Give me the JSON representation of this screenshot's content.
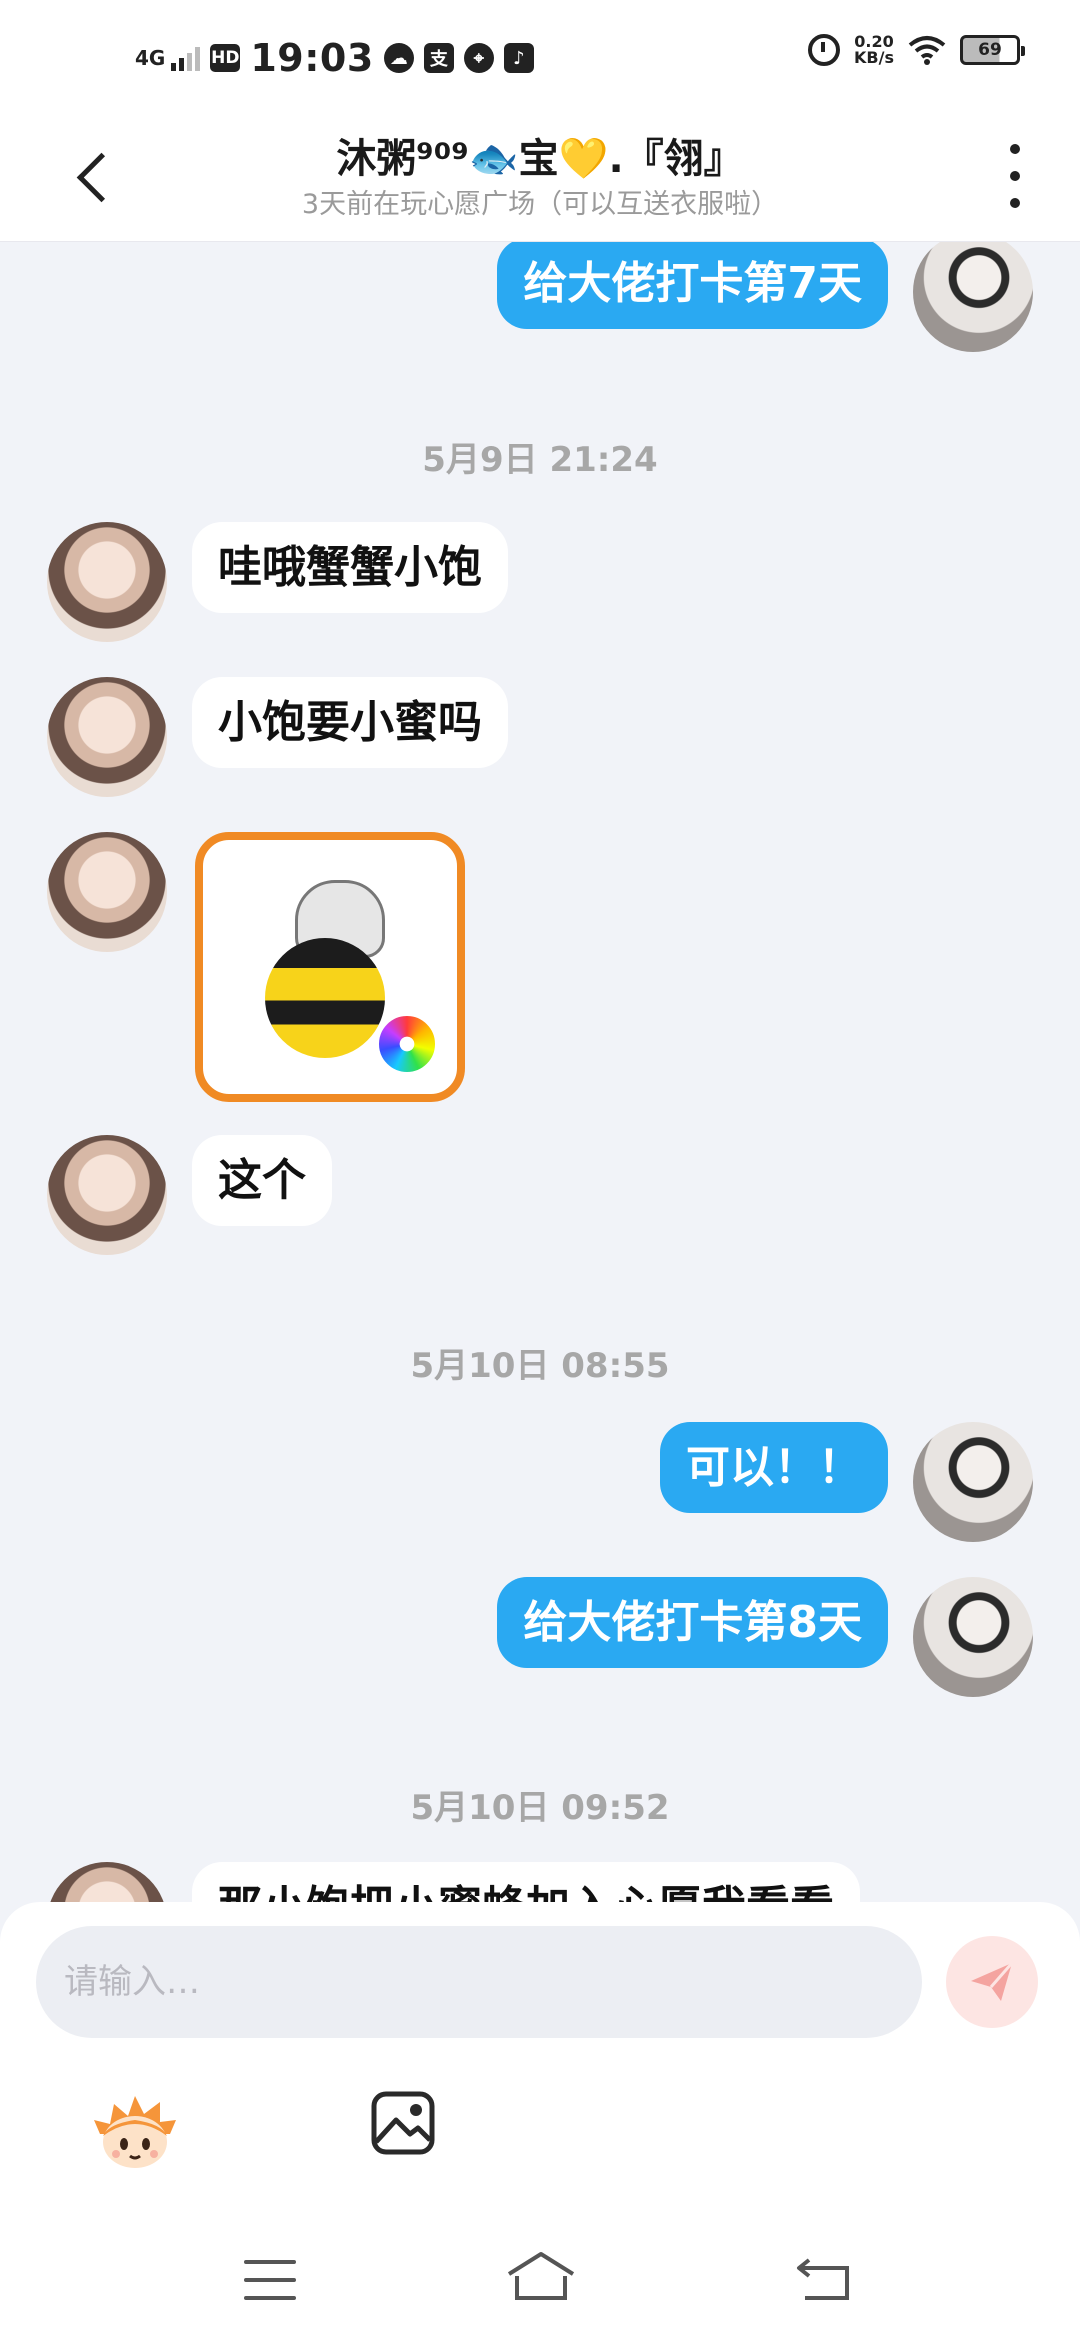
{
  "status_bar": {
    "network": "4G",
    "hd": "HD",
    "time": "19:03",
    "speed_value": "0.20",
    "speed_unit": "KB/s",
    "battery": "69"
  },
  "header": {
    "title": "沐粥⁹⁰⁹🐟宝💛.『翎』",
    "subtitle": "3天前在玩心愿广场（可以互送衣服啦）"
  },
  "messages": [
    {
      "side": "out",
      "text": "给大佬打卡第7天"
    },
    {
      "type": "time",
      "text": "5月9日 21:24"
    },
    {
      "side": "in",
      "text": "哇哦蟹蟹小饱"
    },
    {
      "side": "in",
      "text": "小饱要小蜜吗"
    },
    {
      "side": "in",
      "type": "sticker"
    },
    {
      "side": "in",
      "text": "这个"
    },
    {
      "type": "time",
      "text": "5月10日 08:55"
    },
    {
      "side": "out",
      "text": "可以！！"
    },
    {
      "side": "out",
      "text": "给大佬打卡第8天"
    },
    {
      "type": "time",
      "text": "5月10日 09:52"
    },
    {
      "side": "in",
      "text": "那小饱把小蜜蜂加入心愿我看看"
    }
  ],
  "input": {
    "placeholder": "请输入…"
  },
  "colors": {
    "outgoing_bubble": "#2aa9f2",
    "incoming_bubble": "#ffffff",
    "sticker_border": "#f08a24",
    "send_button_bg": "#fde5e3",
    "send_button_icon": "#f4a4a0"
  },
  "icons": {
    "back": "chevron-left-icon",
    "more": "more-vertical-icon",
    "send": "send-icon",
    "emoji": "mascot-face-icon",
    "image": "image-icon"
  }
}
